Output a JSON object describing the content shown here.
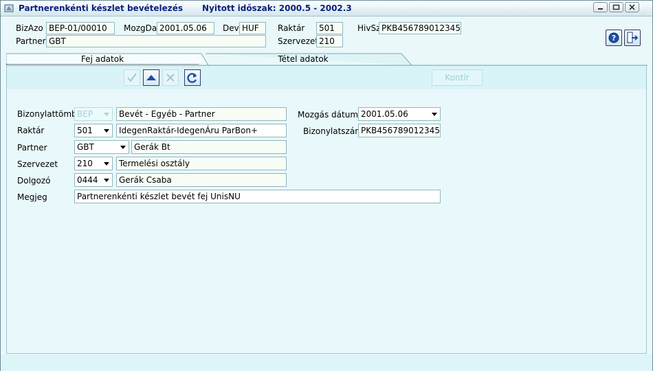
{
  "window": {
    "title": "Partnerenkénti készlet bevételezés",
    "period": "Nyitott időszak: 2000.5 - 2002.3"
  },
  "header": {
    "bizazo_label": "BizAzo",
    "bizazo_value": "BEP-01/00010",
    "mozgdat_label": "MozgDat",
    "mozgdat_value": "2001.05.06",
    "dev_label": "Dev",
    "dev_value": "HUF",
    "raktar_label": "Raktár",
    "raktar_value": "501",
    "hivsz_label": "HivSz",
    "hivsz_value": "PKB456789012345",
    "partner_label": "Partner",
    "partner_value": "GBT",
    "szervezet_label": "Szervezet",
    "szervezet_value": "210"
  },
  "tabs": [
    {
      "label": "Fej adatok",
      "active": true
    },
    {
      "label": "Tétel adatok",
      "active": false
    }
  ],
  "toolbar": {
    "kontir_label": "Kontír"
  },
  "form": {
    "bizonylattomb_label": "Bizonylattömb",
    "bizonylattomb_value": "BEP",
    "bizonylattomb_desc": "Bevét - Egyéb - Partner",
    "raktar_label": "Raktár",
    "raktar_value": "501",
    "raktar_desc": "IdegenRaktár-IdegenÁru ParBon+",
    "partner_label": "Partner",
    "partner_value": "GBT",
    "partner_desc": "Gerák Bt",
    "szervezet_label": "Szervezet",
    "szervezet_value": "210",
    "szervezet_desc": "Termelési osztály",
    "dolgozo_label": "Dolgozó",
    "dolgozo_value": "0444",
    "dolgozo_desc": "Gerák Csaba",
    "megjeg_label": "Megjeg",
    "megjeg_value": "Partnerenkénti készlet bevét fej UnisNU",
    "mozgas_label": "Mozgás dátuma",
    "mozgas_value": "2001.05.06",
    "bizonylatszam_label": "Bizonylatszám",
    "bizonylatszam_value": "PKB456789012345"
  },
  "icons": {
    "help": "help-icon",
    "exit": "exit-icon",
    "ok": "checkmark-icon",
    "up": "arrow-up-icon",
    "delete": "x-icon",
    "refresh": "refresh-icon"
  },
  "colors": {
    "title_text": "#0b1f7a",
    "background": "#eaf8fa",
    "panel": "#e9f8fb"
  }
}
